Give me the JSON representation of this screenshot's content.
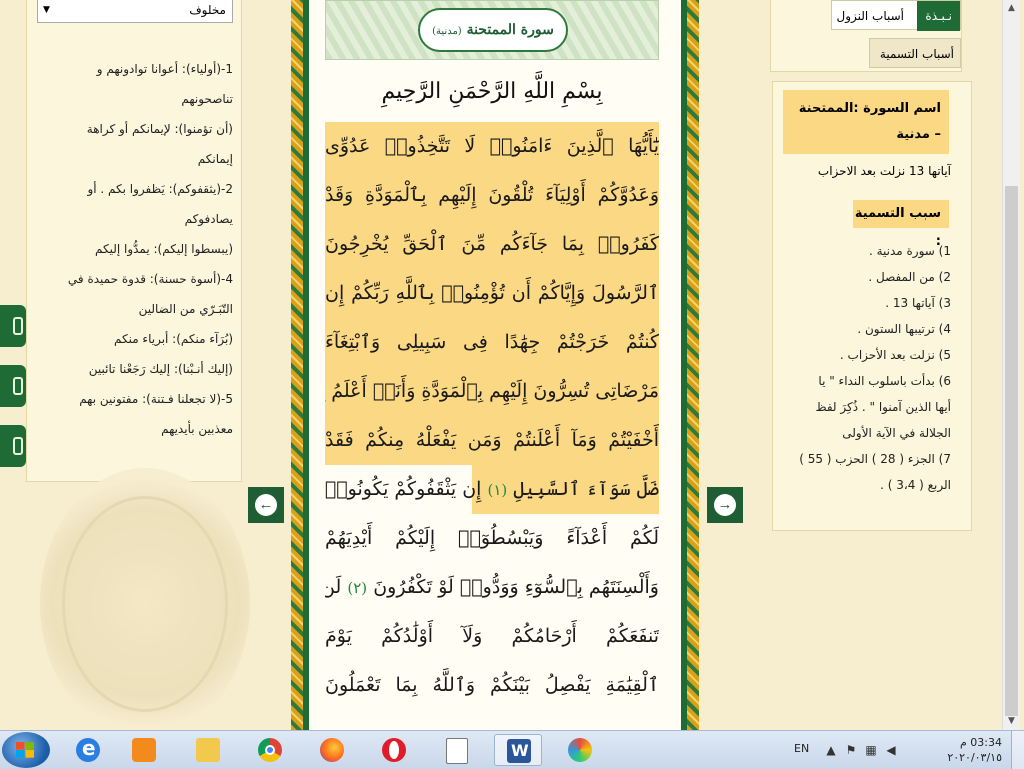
{
  "gloss": {
    "selected": "مخلوف",
    "lines": [
      "1-(أولياء): أعوانا توادونهم و",
      "تناصحونهم",
      "(أن تؤمنوا): لإيمانكم أو كراهة",
      "إيمانكم",
      "2-(يثقفوكم): يَظفروا بكم . أو",
      "يصادفوكم",
      "(يبسطوا إليكم): يمدُّوا إليكم",
      "4-(أسوة حسنة): قدوة حميدة في",
      "التّبَـرّي من الضالين",
      "(بُرَآء منكم): أبرياء منكم",
      "(إليك أنـبْنا): إليك رَجَعْنا تائبين",
      "5-(لا تجعلنا فـتنة): مفتونين بهم",
      "معذبين بأيديهم"
    ]
  },
  "surah": {
    "title": "سورة الممتحنة",
    "subtitle": "(مدنية)",
    "basmala": "بِسْمِ اللَّهِ الرَّحْمَنِ الرَّحِيمِ"
  },
  "verse_lines": [
    "يَٰٓأَيُّهَا ٱلَّذِينَ ءَامَنُوا۟ لَا تَتَّخِذُوا۟ عَدُوِّى",
    "وَعَدُوَّكُمْ أَوْلِيَآءَ تُلْقُونَ إِلَيْهِم بِٱلْمَوَدَّةِ وَقَدْ",
    "كَفَرُوا۟ بِمَا جَآءَكُم مِّنَ ٱلْحَقِّ يُخْرِجُونَ",
    "ٱلرَّسُولَ وَإِيَّاكُمْ أَن تُؤْمِنُوا۟ بِٱللَّهِ رَبِّكُمْ إِن",
    "كُنتُمْ خَرَجْتُمْ جِهَٰدًا فِى سَبِيلِى وَٱبْتِغَآءَ",
    "مَرْضَاتِى تُسِرُّونَ إِلَيْهِم بِٱلْمَوَدَّةِ وَأَنَا۠ أَعْلَمُ بِمَآ",
    "أَخْفَيْتُمْ وَمَآ أَعْلَنتُمْ وَمَن يَفْعَلْهُ مِنكُمْ فَقَدْ",
    "ضَلَّ سَوَآءَ ٱلسَّبِيلِ",
    "لَكُمْ أَعْدَآءً وَيَبْسُطُوٓا۟ إِلَيْكُمْ أَيْدِيَهُمْ",
    "وَأَلْسِنَتَهُم بِٱلسُّوٓءِ وَوَدُّوا۟ لَوْ تَكْفُرُونَ",
    "تَنفَعَكُمْ أَرْحَامُكُمْ وَلَآ أَوْلَٰدُكُمْ يَوْمَ",
    "ٱلْقِيَٰمَةِ يَفْصِلُ بَيْنَكُمْ وَٱللَّهُ بِمَا تَعْمَلُونَ"
  ],
  "verse_fragments": {
    "ayah1": "(١)",
    "line8_rest": "إِن يَثْقَفُوكُمْ يَكُونُوا۟",
    "ayah2": "(٢)",
    "line10_rest": "لَن"
  },
  "tabs": {
    "badge": "نـبـذة",
    "causes": "أسباب النزول",
    "naming": "أسباب التسمية"
  },
  "info": {
    "surah_name": "اسم السورة :الممتحنة – مدنية",
    "ayat": "آياتها 13 نزلت بعد الاحزاب",
    "naming_head": "سبب التسمية :",
    "facts": [
      "1) سورة مدنية .",
      "2) من المفصل .",
      "3) آياتها 13 .",
      "4) ترتيبها الستون .",
      "5) نزلت بعد الأحزاب .",
      "6) بدأت باسلوب النداء \" يا",
      "أيها الذين آمنوا \" . ذُكِرَ لفظ",
      "الجلالة في الآية الأولى",
      "7) الجزء ( 28 ) الحزب ( 55 )",
      "الربع ( 3،4 ) ."
    ]
  },
  "nav": {
    "prev_glyph": "←",
    "next_glyph": "→"
  },
  "taskbar": {
    "lang": "EN",
    "time": "03:34 م",
    "date": "٢٠٢٠/٠٣/١٥"
  },
  "colors": {
    "frame_green": "#1f6b35",
    "highlight": "#fbd883",
    "panel_bg": "#fbf6dc",
    "page_bg": "#f7edcf"
  }
}
